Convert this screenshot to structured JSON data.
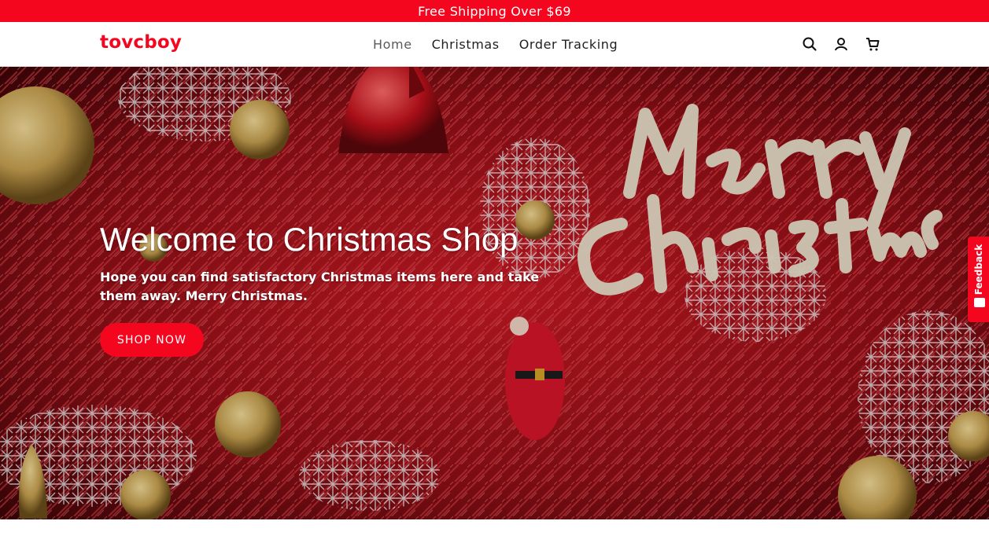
{
  "announcement": {
    "text": "Free Shipping Over $69"
  },
  "header": {
    "logo": "tovcboy",
    "nav": [
      {
        "label": "Home",
        "active": true
      },
      {
        "label": "Christmas",
        "active": false
      },
      {
        "label": "Order Tracking",
        "active": false
      }
    ],
    "icons": [
      "search-icon",
      "account-icon",
      "cart-icon"
    ]
  },
  "hero": {
    "title": "Welcome to Christmas Shop",
    "subtitle": "Hope you can find satisfactory Christmas items here and take them away. Merry Christmas.",
    "button_label": "SHOP NOW",
    "banner_text": [
      "Merry",
      "Christmas"
    ]
  },
  "feedback": {
    "label": "Feedback"
  },
  "colors": {
    "brand": "#f5061f",
    "text": "#1e1e1e"
  }
}
